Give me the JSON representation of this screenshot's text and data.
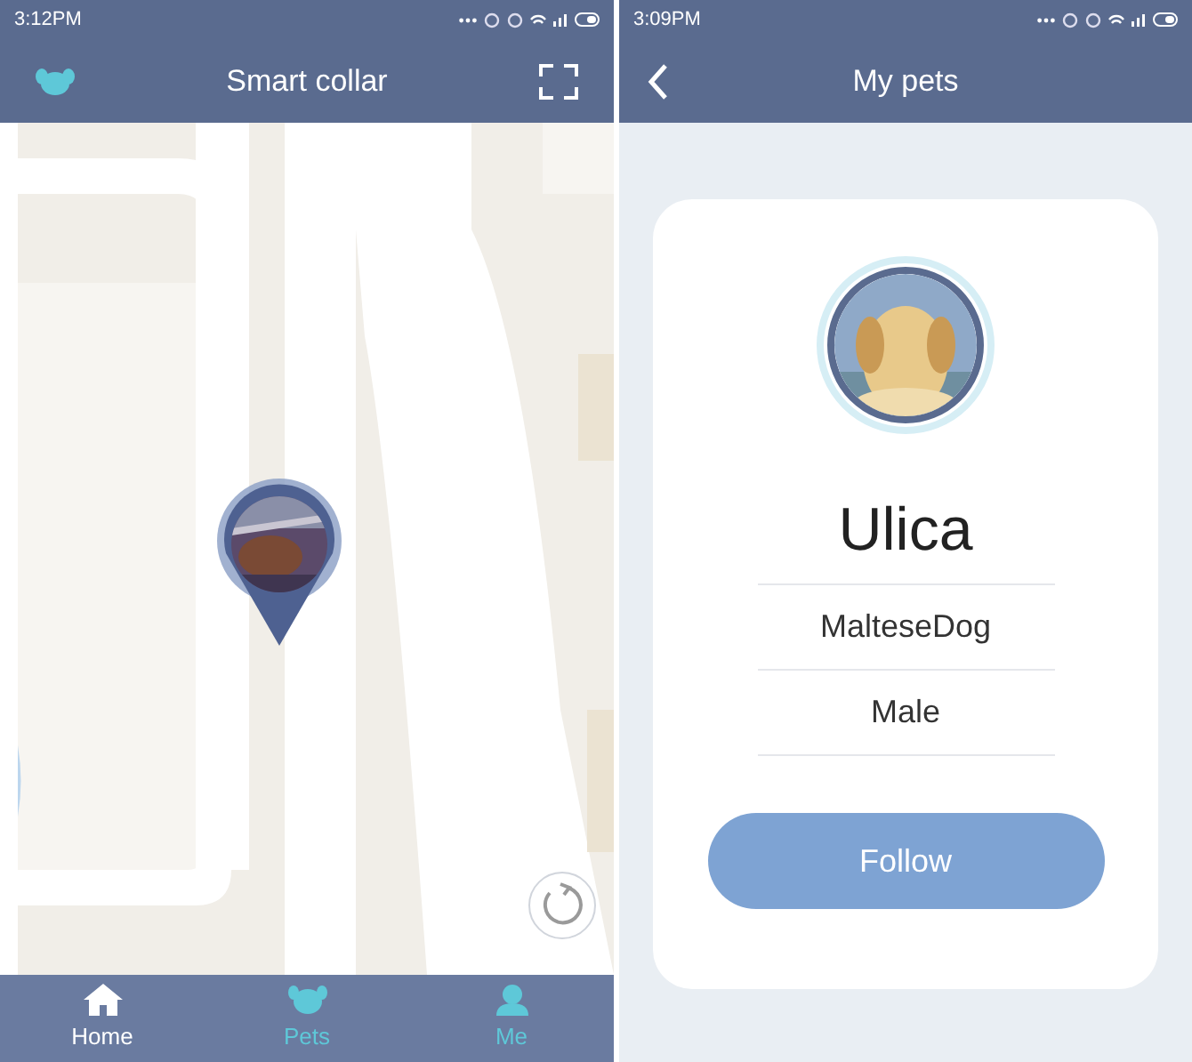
{
  "left_screen": {
    "status_bar": {
      "time": "3:12PM"
    },
    "header": {
      "title": "Smart collar"
    },
    "bottom_nav": [
      {
        "label": "Home",
        "kind": "home",
        "selected": true
      },
      {
        "label": "Pets",
        "kind": "pets",
        "selected": false
      },
      {
        "label": "Me",
        "kind": "me",
        "selected": false
      }
    ]
  },
  "right_screen": {
    "status_bar": {
      "time": "3:09PM"
    },
    "header": {
      "title": "My pets"
    },
    "pet": {
      "name": "Ulica",
      "breed": "MalteseDog",
      "sex": "Male"
    },
    "follow_button": "Follow"
  }
}
